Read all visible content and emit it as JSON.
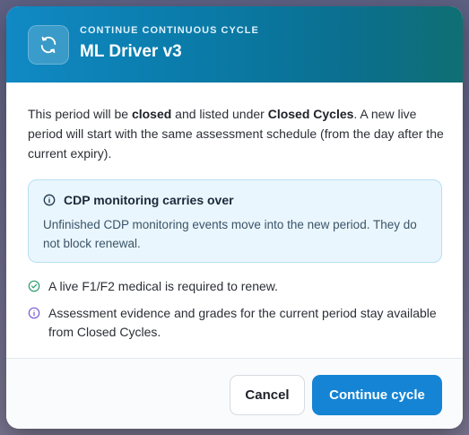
{
  "dialog": {
    "eyebrow": "CONTINUE CONTINUOUS CYCLE",
    "title": "ML Driver v3",
    "icon": "refresh-icon"
  },
  "intro": {
    "part1": "This period will be ",
    "bold1": "closed",
    "part2": " and listed under ",
    "bold2": "Closed Cycles",
    "part3": ". A new live period will start with the same assessment schedule (from the day after the current expiry)."
  },
  "info_box": {
    "icon": "info-icon",
    "title": "CDP monitoring carries over",
    "text": "Unfinished CDP monitoring events move into the new period. They do not block renewal."
  },
  "notes": [
    {
      "icon": "check-circle-icon",
      "text": "A live F1/F2 medical is required to renew."
    },
    {
      "icon": "info-icon",
      "text": "Assessment evidence and grades for the current period stay available from Closed Cycles."
    }
  ],
  "footer": {
    "cancel_label": "Cancel",
    "continue_label": "Continue cycle"
  },
  "colors": {
    "header_start": "#1089c4",
    "header_end": "#0f6f73",
    "primary_button": "#1584d4",
    "info_bg": "#eaf6fd",
    "info_border": "#b7dff3",
    "check_green": "#2e9e6e",
    "info_purple": "#7b5cd6"
  }
}
